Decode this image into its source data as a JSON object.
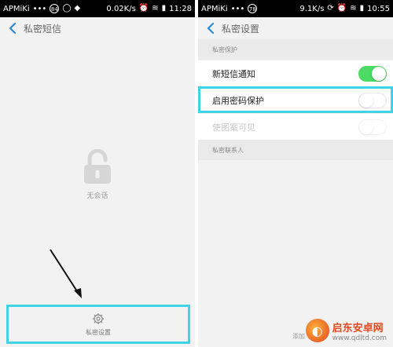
{
  "left": {
    "status": {
      "carrier": "APMiKi",
      "dots": "•••",
      "badge": "84",
      "net": "0.02K/s",
      "time": "11:28"
    },
    "nav": {
      "title": "私密短信"
    },
    "empty": {
      "text": "无会话"
    },
    "bottom": {
      "label": "私密设置"
    }
  },
  "right": {
    "status": {
      "carrier": "APMiKi",
      "dots": "•••",
      "badge": "78",
      "net": "9.1K/s",
      "time": "10:55"
    },
    "nav": {
      "title": "私密设置"
    },
    "sections": [
      {
        "header": "私密保护"
      },
      {
        "header": "私密联系人"
      }
    ],
    "rows": [
      {
        "label": "新短信通知",
        "toggle": "on"
      },
      {
        "label": "启用密码保护",
        "toggle": "off"
      },
      {
        "label": "使图案可见",
        "toggle": "off"
      }
    ],
    "bottom_partial": "添加",
    "watermark": {
      "title": "启东安卓网",
      "url": "www.qdltd.com"
    }
  },
  "colors": {
    "highlight": "#3fd3e6",
    "toggle_on": "#4cd964"
  }
}
